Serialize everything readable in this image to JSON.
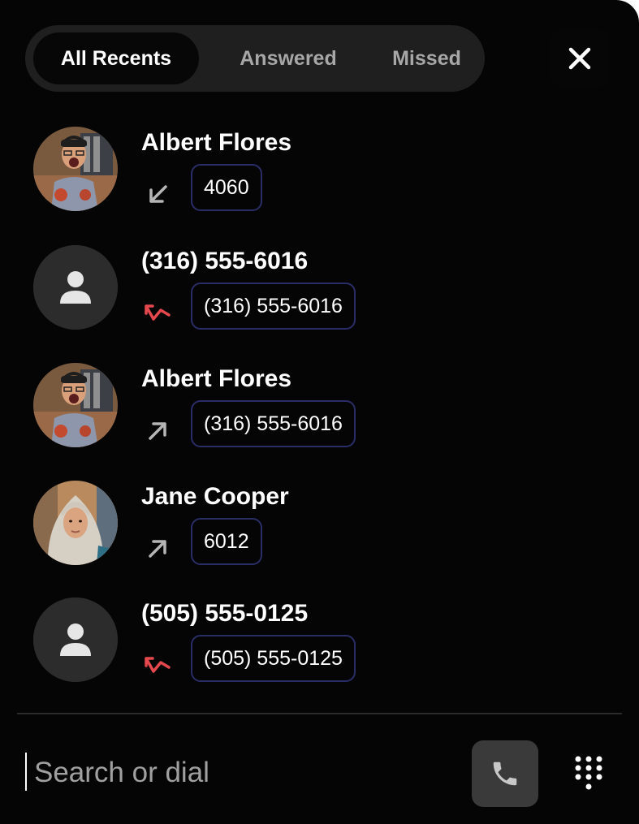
{
  "tabs": [
    {
      "label": "All Recents",
      "active": true
    },
    {
      "label": "Answered",
      "active": false
    },
    {
      "label": "Missed",
      "active": false
    }
  ],
  "calls": [
    {
      "name": "Albert Flores",
      "number": "4060",
      "direction": "incoming",
      "avatar": "photo"
    },
    {
      "name": "(316) 555-6016",
      "number": "(316) 555-6016",
      "direction": "missed",
      "avatar": "placeholder"
    },
    {
      "name": "Albert Flores",
      "number": "(316) 555-6016",
      "direction": "outgoing",
      "avatar": "photo"
    },
    {
      "name": "Jane Cooper",
      "number": "6012",
      "direction": "outgoing",
      "avatar": "photo"
    },
    {
      "name": "(505) 555-0125",
      "number": "(505) 555-0125",
      "direction": "missed",
      "avatar": "placeholder"
    }
  ],
  "search": {
    "placeholder": "Search or dial",
    "value": ""
  },
  "icons": {
    "close": "close-icon",
    "call": "phone-icon",
    "dialpad": "dialpad-icon",
    "incoming": "arrow-down-left-icon",
    "outgoing": "arrow-up-right-icon",
    "missed": "missed-call-icon",
    "placeholder_avatar": "user-icon"
  },
  "colors": {
    "background": "#050505",
    "tab_bar": "#1f1f1f",
    "chip_border": "#2a2e66",
    "missed": "#e5484d",
    "direction_neutral": "#b5b5b5",
    "call_button": "#3a3a3a"
  }
}
